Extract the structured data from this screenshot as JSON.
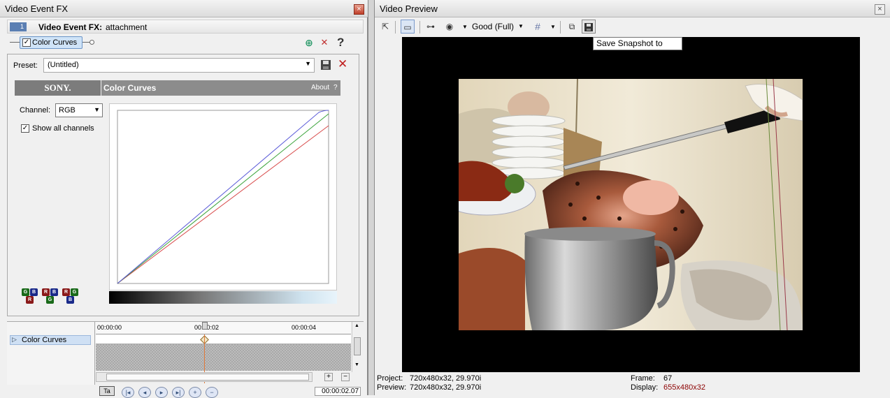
{
  "fx_window": {
    "title": "Video Event FX",
    "event_badge": "1",
    "heading_bold": "Video Event FX:",
    "heading_name": "attachment",
    "chain_item": "Color Curves",
    "help_glyph": "?",
    "preset_label": "Preset:",
    "preset_value": "(Untitled)",
    "plugin": {
      "brand": "SONY.",
      "name": "Color Curves",
      "about": "About",
      "about_q": "?"
    },
    "channel_label": "Channel:",
    "channel_value": "RGB",
    "show_all_label": "Show all channels",
    "timeline": {
      "t0": "00:00:00",
      "t1": "00:00:02",
      "t2": "00:00:04",
      "track_label": "Color Curves",
      "current_time": "00:00:02.07"
    },
    "swatch_groups": [
      [
        "G",
        "B",
        "R"
      ],
      [
        "R",
        "B",
        "G"
      ],
      [
        "R",
        "G",
        "B"
      ]
    ]
  },
  "preview_window": {
    "title": "Video Preview",
    "quality": "Good (Full)",
    "tooltip": "Save Snapshot to File...",
    "status": {
      "project_label": "Project:",
      "project_value": "720x480x32, 29.970i",
      "preview_label": "Preview:",
      "preview_value": "720x480x32, 29.970i",
      "frame_label": "Frame:",
      "frame_value": "67",
      "display_label": "Display:",
      "display_value": "655x480x32"
    }
  },
  "colors": {
    "curve_red": "#d84a4a",
    "curve_green": "#3aa33a",
    "curve_blue": "#5a5ad8",
    "display_value": "#8b0000"
  },
  "icons": [
    "close-icon",
    "add-fx-icon",
    "remove-fx-icon",
    "help-icon",
    "save-preset-icon",
    "delete-preset-icon",
    "dropdown-icon",
    "play-icon",
    "snapshot-icon",
    "copy-icon",
    "grid-icon",
    "split-icon",
    "overlay-icon"
  ]
}
